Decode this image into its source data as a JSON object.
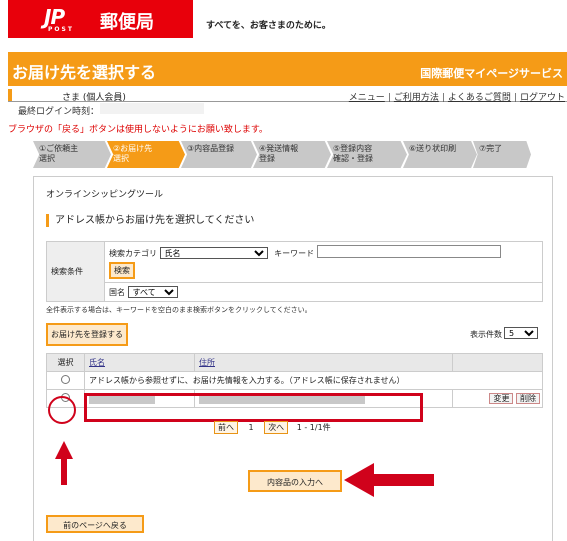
{
  "header": {
    "logo_mark": "JP",
    "logo_sub": "POST",
    "logo_name": "郵便局",
    "tagline": "すべてを、お客さまのために。"
  },
  "titlebar": {
    "title": "お届け先を選択する",
    "service": "国際郵便マイページサービス"
  },
  "user": {
    "suffix": "さま (個人会員)",
    "last_login_label": "最終ログイン時刻："
  },
  "nav": {
    "menu": "メニュー",
    "usage": "ご利用方法",
    "faq": "よくあるご質問",
    "logout": "ログアウト"
  },
  "warning": "ブラウザの「戻る」ボタンは使用しないようにお願い致します。",
  "steps": [
    {
      "label": "①ご依頼主\n選択",
      "active": false
    },
    {
      "label": "②お届け先\n選択",
      "active": true
    },
    {
      "label": "③内容品登録",
      "active": false
    },
    {
      "label": "④発送情報\n登録",
      "active": false
    },
    {
      "label": "⑤登録内容\n確認・登録",
      "active": false
    },
    {
      "label": "⑥送り状印刷",
      "active": false
    },
    {
      "label": "⑦完了",
      "active": false
    }
  ],
  "panel": {
    "title": "オンラインシッピングツール",
    "section": "アドレス帳からお届け先を選択してください"
  },
  "search": {
    "label": "検索条件",
    "category_label": "検索カテゴリ",
    "category_value": "氏名",
    "keyword_label": "キーワード",
    "search_button": "検索",
    "country_label": "国名",
    "country_value": "すべて",
    "hint": "全件表示する場合は、キーワードを空白のまま検索ボタンをクリックしてください。"
  },
  "list": {
    "register_button": "お届け先を登録する",
    "count_label": "表示件数",
    "count_value": "5",
    "col_select": "選択",
    "col_name": "氏名",
    "col_address": "住所",
    "no_addressbook": "アドレス帳から参照せずに、お届け先情報を入力する。（アドレス帳に保存されません）",
    "edit_button": "変更",
    "delete_button": "削除"
  },
  "pager": {
    "prev": "前へ",
    "page": "1",
    "next": "次へ",
    "range": "1 - 1/1件"
  },
  "actions": {
    "next_button": "内容品の入力へ",
    "back_button": "前のページへ戻る"
  },
  "colors": {
    "brand_red": "#e8000b",
    "accent_orange": "#f59b17",
    "highlight_red": "#d0021b"
  }
}
